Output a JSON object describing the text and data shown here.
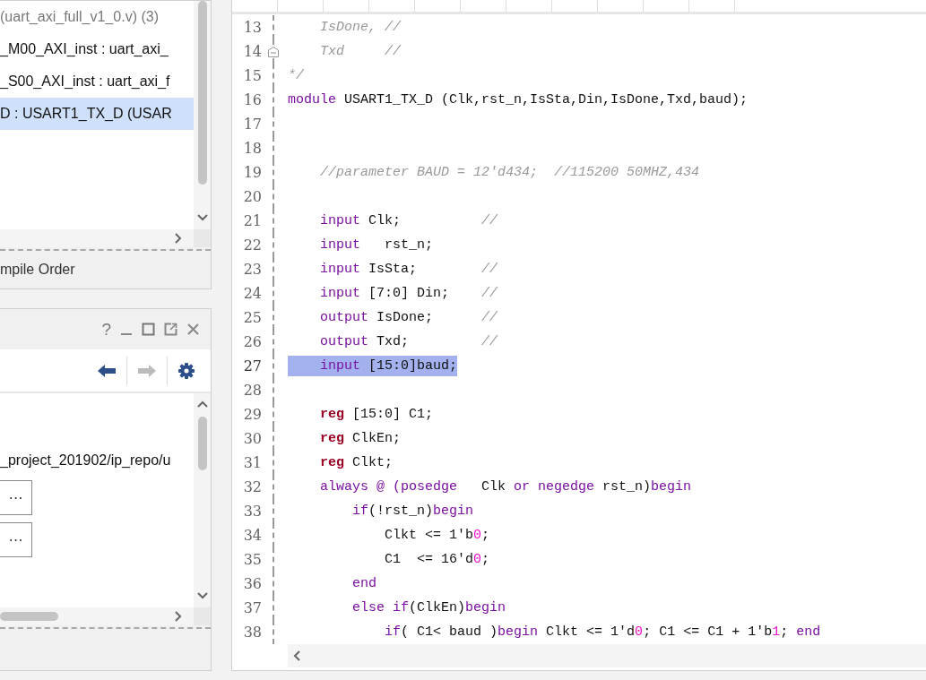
{
  "hierarchy": {
    "items": [
      {
        "text": "(uart_axi_full_v1_0.v) (3)",
        "kind": "file",
        "selected": false
      },
      {
        "text": "_M00_AXI_inst : uart_axi_",
        "kind": "instance",
        "selected": false
      },
      {
        "text": "_S00_AXI_inst : uart_axi_f",
        "kind": "instance",
        "selected": false
      },
      {
        "text": "D : USART1_TX_D (USAR",
        "kind": "instance",
        "selected": true
      }
    ],
    "tab": "mpile Order"
  },
  "properties": {
    "help": "?",
    "path": "_project_201902/ip_repo/u",
    "buttons": [
      "⋯",
      "⋯"
    ],
    "forward_disabled": true
  },
  "editor": {
    "code_lines": [
      {
        "number": "13",
        "fold": false,
        "selected": false,
        "tokens": [
          {
            "kind": "comment",
            "text": "    IsDone, //"
          }
        ]
      },
      {
        "number": "14",
        "fold": true,
        "selected": false,
        "tokens": [
          {
            "kind": "comment",
            "text": "    Txd     //"
          }
        ]
      },
      {
        "number": "15",
        "fold": false,
        "selected": false,
        "tokens": [
          {
            "kind": "comment",
            "text": "*/"
          }
        ]
      },
      {
        "number": "16",
        "fold": false,
        "selected": false,
        "tokens": [
          {
            "kind": "kw",
            "text": "module"
          },
          {
            "kind": "plain",
            "text": " USART1_TX_D (Clk,rst_n,IsSta,Din,IsDone,Txd,baud);"
          }
        ]
      },
      {
        "number": "17",
        "fold": false,
        "selected": false
      },
      {
        "number": "18",
        "fold": false,
        "selected": false
      },
      {
        "number": "19",
        "fold": false,
        "selected": false,
        "tokens": [
          {
            "kind": "comment",
            "text": "    //parameter BAUD = 12'd434;  //115200 50MHZ,434"
          }
        ]
      },
      {
        "number": "20",
        "fold": false,
        "selected": false
      },
      {
        "number": "21",
        "fold": false,
        "selected": false,
        "tokens": [
          {
            "kind": "kw",
            "text": "    input"
          },
          {
            "kind": "plain",
            "text": " Clk;          "
          },
          {
            "kind": "comment",
            "text": "//"
          }
        ]
      },
      {
        "number": "22",
        "fold": false,
        "selected": false,
        "tokens": [
          {
            "kind": "kw",
            "text": "    input"
          },
          {
            "kind": "plain",
            "text": "   rst_n;"
          }
        ]
      },
      {
        "number": "23",
        "fold": false,
        "selected": false,
        "tokens": [
          {
            "kind": "kw",
            "text": "    input"
          },
          {
            "kind": "plain",
            "text": " IsSta;        "
          },
          {
            "kind": "comment",
            "text": "//"
          }
        ]
      },
      {
        "number": "24",
        "fold": false,
        "selected": false,
        "tokens": [
          {
            "kind": "kw",
            "text": "    input"
          },
          {
            "kind": "plain",
            "text": " [7:0] Din;    "
          },
          {
            "kind": "comment",
            "text": "//"
          }
        ]
      },
      {
        "number": "25",
        "fold": false,
        "selected": false,
        "tokens": [
          {
            "kind": "kw",
            "text": "    output"
          },
          {
            "kind": "plain",
            "text": " IsDone;      "
          },
          {
            "kind": "comment",
            "text": "//"
          }
        ]
      },
      {
        "number": "26",
        "fold": false,
        "selected": false,
        "tokens": [
          {
            "kind": "kw",
            "text": "    output"
          },
          {
            "kind": "plain",
            "text": " Txd;         "
          },
          {
            "kind": "comment",
            "text": "//"
          }
        ]
      },
      {
        "number": "27",
        "fold": false,
        "selected": true,
        "tokens": [
          {
            "kind": "kw",
            "text": "    input"
          },
          {
            "kind": "plain",
            "text": " [15:0]baud;"
          }
        ]
      },
      {
        "number": "28",
        "fold": false,
        "selected": false
      },
      {
        "number": "29",
        "fold": false,
        "selected": false,
        "tokens": [
          {
            "kind": "reg",
            "text": "    reg"
          },
          {
            "kind": "plain",
            "text": " [15:0] C1;"
          }
        ]
      },
      {
        "number": "30",
        "fold": false,
        "selected": false,
        "tokens": [
          {
            "kind": "reg",
            "text": "    reg"
          },
          {
            "kind": "plain",
            "text": " ClkEn;"
          }
        ]
      },
      {
        "number": "31",
        "fold": false,
        "selected": false,
        "tokens": [
          {
            "kind": "reg",
            "text": "    reg"
          },
          {
            "kind": "plain",
            "text": " Clkt;"
          }
        ]
      },
      {
        "number": "32",
        "fold": false,
        "selected": false,
        "tokens": [
          {
            "kind": "kw",
            "text": "    always @ (posedge"
          },
          {
            "kind": "plain",
            "text": "   Clk "
          },
          {
            "kind": "kw",
            "text": "or negedge"
          },
          {
            "kind": "plain",
            "text": " rst_n)"
          },
          {
            "kind": "kw",
            "text": "begin"
          }
        ]
      },
      {
        "number": "33",
        "fold": false,
        "selected": false,
        "tokens": [
          {
            "kind": "kw",
            "text": "        if"
          },
          {
            "kind": "plain",
            "text": "(!rst_n)"
          },
          {
            "kind": "kw",
            "text": "begin"
          }
        ]
      },
      {
        "number": "34",
        "fold": false,
        "selected": false,
        "tokens": [
          {
            "kind": "plain",
            "text": "            Clkt <= 1'b"
          },
          {
            "kind": "num",
            "text": "0"
          },
          {
            "kind": "plain",
            "text": ";"
          }
        ]
      },
      {
        "number": "35",
        "fold": false,
        "selected": false,
        "tokens": [
          {
            "kind": "plain",
            "text": "            C1  <= 16'd"
          },
          {
            "kind": "num",
            "text": "0"
          },
          {
            "kind": "plain",
            "text": ";"
          }
        ]
      },
      {
        "number": "36",
        "fold": false,
        "selected": false,
        "tokens": [
          {
            "kind": "kw",
            "text": "        end"
          }
        ]
      },
      {
        "number": "37",
        "fold": false,
        "selected": false,
        "tokens": [
          {
            "kind": "kw",
            "text": "        else if"
          },
          {
            "kind": "plain",
            "text": "(ClkEn)"
          },
          {
            "kind": "kw",
            "text": "begin"
          }
        ]
      },
      {
        "number": "38",
        "fold": false,
        "selected": false,
        "tokens": [
          {
            "kind": "kw",
            "text": "            if"
          },
          {
            "kind": "plain",
            "text": "( C1< baud )"
          },
          {
            "kind": "kw",
            "text": "begin"
          },
          {
            "kind": "plain",
            "text": " Clkt <= 1'd"
          },
          {
            "kind": "num",
            "text": "0"
          },
          {
            "kind": "plain",
            "text": "; C1 <= C1 + 1'b"
          },
          {
            "kind": "num",
            "text": "1"
          },
          {
            "kind": "plain",
            "text": "; "
          },
          {
            "kind": "kw",
            "text": "end"
          }
        ]
      }
    ]
  }
}
